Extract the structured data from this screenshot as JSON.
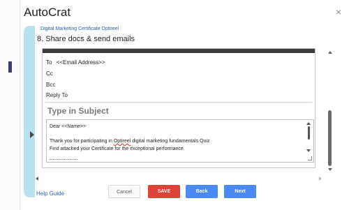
{
  "dialog": {
    "title": "AutoCrat",
    "close_symbol": "×"
  },
  "breadcrumb": "Digital Marketing Certificate Optireel",
  "step_title": "8. Share docs & send emails",
  "email": {
    "to_label": "To",
    "to_value": "<<Email Address>>",
    "cc_label": "Cc",
    "bcc_label": "Bcc",
    "reply_to_label": "Reply To",
    "subject_placeholder": "Type in Subject",
    "body": {
      "greeting": "Dear <<Name>>",
      "line1_before": "Thank you for participating in ",
      "line1_misspelled": "Optireel",
      "line1_after": " digital marketing fundamentals Quiz",
      "line2": "Find attached your Certificate for the exceptional performance."
    }
  },
  "footer": {
    "help_label": "Help Guide",
    "cancel_label": "Cancel",
    "save_label": "SAVE",
    "back_label": "Back",
    "next_label": "Next"
  },
  "colors": {
    "save": "#dd4336",
    "primary": "#4a8af4",
    "side_tab": "#b8e1f0",
    "link": "#2a5db0"
  }
}
